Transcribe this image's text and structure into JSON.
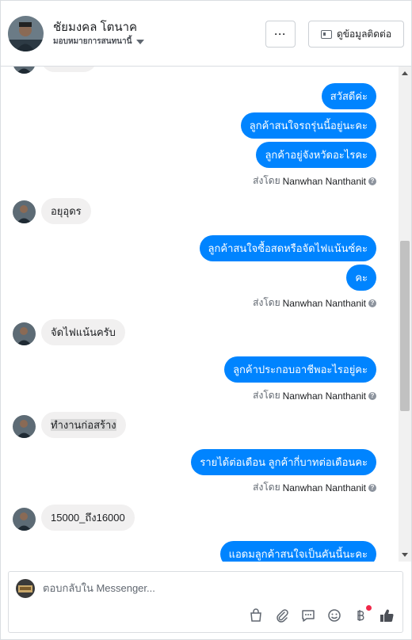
{
  "header": {
    "contact_name": "ชัยมงคล โตนาค",
    "assign_label": "มอบหมายการสนทนานี้",
    "more_label": "···",
    "contact_info_label": "ดูข้อมูลติดต่อ"
  },
  "messages": {
    "out_1": "สวัสดีค่ะ",
    "out_2": "ลูกค้าสนใจรถรุ่นนี้อยู่นะคะ",
    "out_3": "ลูกค้าอยู่จังหวัดอะไรคะ",
    "in_1": "อยุอุดร",
    "out_4": "ลูกค้าสนใจซื้อสดหรือจัดไฟแน้นซ์คะ",
    "out_5": "คะ",
    "in_2": "จัดไฟแน้นครับ",
    "out_6": "ลูกค้าประกอบอาชีพอะไรอยู่คะ",
    "in_3": "ทำงานก่อสร้าง",
    "out_7": "รายได้ต่อเดือน ลูกค้ากี่บาทต่อเดือนคะ",
    "in_4": "15000_ถึง16000",
    "out_8": "แอดมลูกค้าสนใจเป็นคันนี้นะคะ"
  },
  "sent_by": {
    "prefix": "ส่งโดย",
    "name": "Nanwhan Nanthanit",
    "help": "?"
  },
  "composer": {
    "placeholder": "ตอบกลับใน Messenger..."
  },
  "icons": [
    "more-icon",
    "contact-card-icon",
    "shopping-bag-icon",
    "attachment-icon",
    "saved-reply-icon",
    "emoji-icon",
    "baht-payment-icon",
    "thumbs-up-icon"
  ],
  "colors": {
    "outgoing_bubble": "#0084ff",
    "incoming_bubble": "#f1f0f0",
    "notification_dot": "#f02849"
  }
}
